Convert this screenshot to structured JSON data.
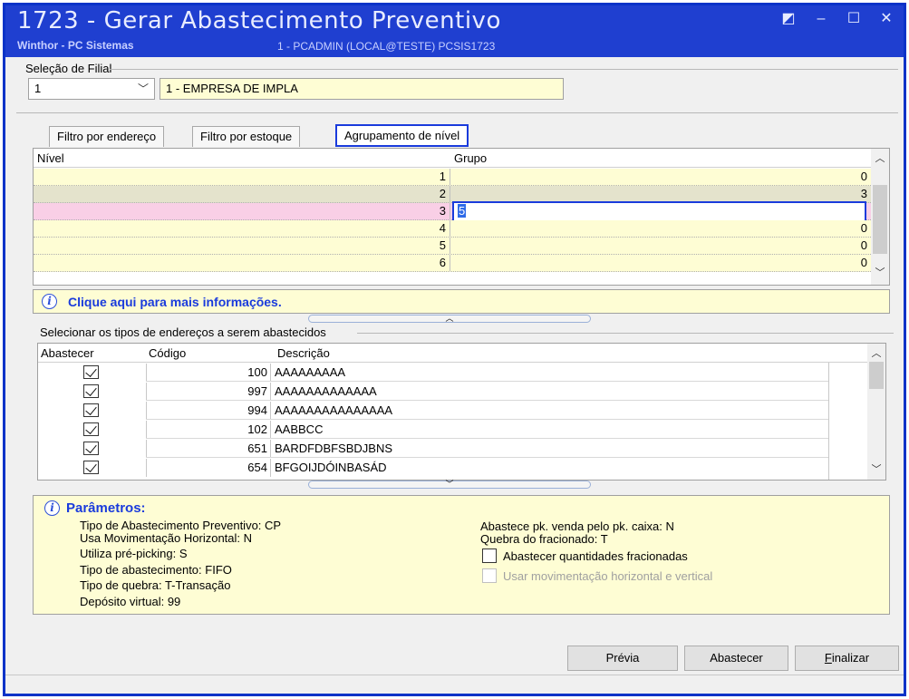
{
  "window": {
    "title": "1723 - Gerar Abastecimento Preventivo",
    "subtitle": "Winthor - PC Sistemas",
    "user_info": "1 - PCADMIN (LOCAL@TESTE)   PCSIS1723"
  },
  "filial": {
    "label": "Seleção de Filial",
    "code": "1",
    "name": "1 - EMPRESA DE IMPLA"
  },
  "tabs": [
    {
      "label": "Filtro por endereço",
      "active": false
    },
    {
      "label": "Filtro por estoque",
      "active": false
    },
    {
      "label": "Agrupamento de nível",
      "active": true
    }
  ],
  "nivel_grid": {
    "headers": [
      "Nível",
      "Grupo"
    ],
    "rows": [
      {
        "nivel": "1",
        "grupo": "0"
      },
      {
        "nivel": "2",
        "grupo": "3"
      },
      {
        "nivel": "3",
        "grupo": "5"
      },
      {
        "nivel": "4",
        "grupo": "0"
      },
      {
        "nivel": "5",
        "grupo": "0"
      },
      {
        "nivel": "6",
        "grupo": "0"
      }
    ],
    "editing_value": "5"
  },
  "info_bar": {
    "text": "Clique aqui para mais informações."
  },
  "enderecos": {
    "group_label": "Selecionar os tipos de endereços a serem abastecidos",
    "headers": [
      "Abastecer",
      "Código",
      "Descrição"
    ],
    "rows": [
      {
        "checked": true,
        "codigo": "100",
        "descricao": "AAAAAAAAA"
      },
      {
        "checked": true,
        "codigo": "997",
        "descricao": "AAAAAAAAAAAAA"
      },
      {
        "checked": true,
        "codigo": "994",
        "descricao": "AAAAAAAAAAAAAAA"
      },
      {
        "checked": true,
        "codigo": "102",
        "descricao": "AABBCC"
      },
      {
        "checked": true,
        "codigo": "651",
        "descricao": "BARDFDBFSBDJBNS"
      },
      {
        "checked": true,
        "codigo": "654",
        "descricao": "BFGOIJDÓINBASÁD"
      }
    ]
  },
  "parametros": {
    "title": "Parâmetros:",
    "left": [
      "Tipo de Abastecimento Preventivo: CP",
      "Usa Movimentação Horizontal: N",
      "Utiliza pré-picking: S",
      "Tipo de abastecimento: FIFO",
      "Tipo de quebra: T-Transação",
      "Depósito virtual: 99"
    ],
    "right": [
      "Abastece pk. venda pelo pk. caixa: N",
      "Quebra do fracionado: T"
    ],
    "check_fracionadas": "Abastecer quantidades fracionadas",
    "check_horizontal_vertical": "Usar movimentação horizontal e vertical"
  },
  "buttons": {
    "previa": "Prévia",
    "abastecer": "Abastecer",
    "finalizar_first": "F",
    "finalizar_rest": "inalizar"
  }
}
